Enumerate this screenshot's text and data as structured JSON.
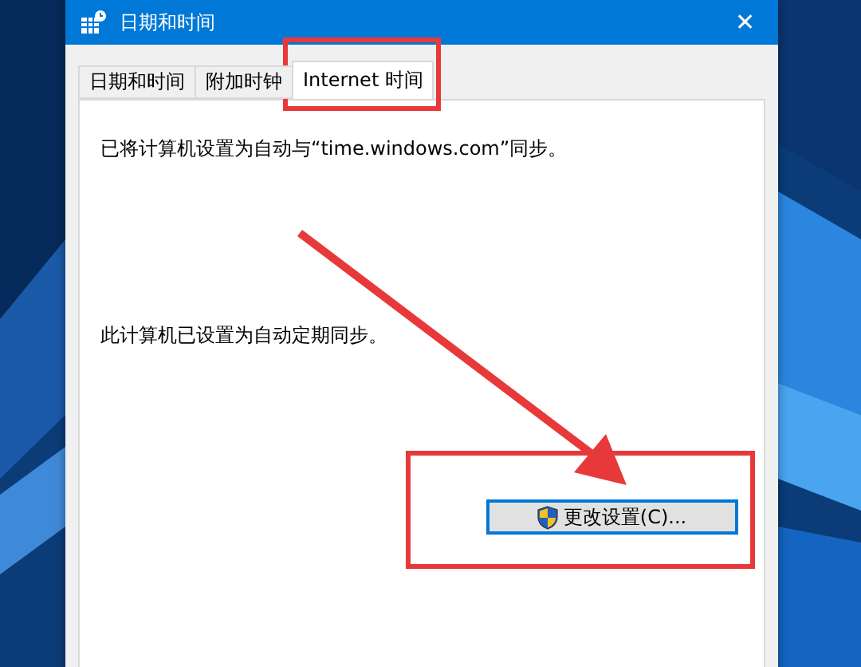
{
  "window": {
    "title": "日期和时间",
    "close": "✕"
  },
  "tabs": [
    {
      "label": "日期和时间",
      "selected": false
    },
    {
      "label": "附加时钟",
      "selected": false
    },
    {
      "label": "Internet 时间",
      "selected": true
    }
  ],
  "panel": {
    "sync_message": "已将计算机设置为自动与“time.windows.com”同步。",
    "schedule_message": "此计算机已设置为自动定期同步。",
    "button": {
      "label": "更改设置(C)..."
    }
  },
  "annotations": [
    {
      "kind": "tab_frame"
    },
    {
      "kind": "arrow"
    },
    {
      "kind": "button_frame"
    }
  ]
}
